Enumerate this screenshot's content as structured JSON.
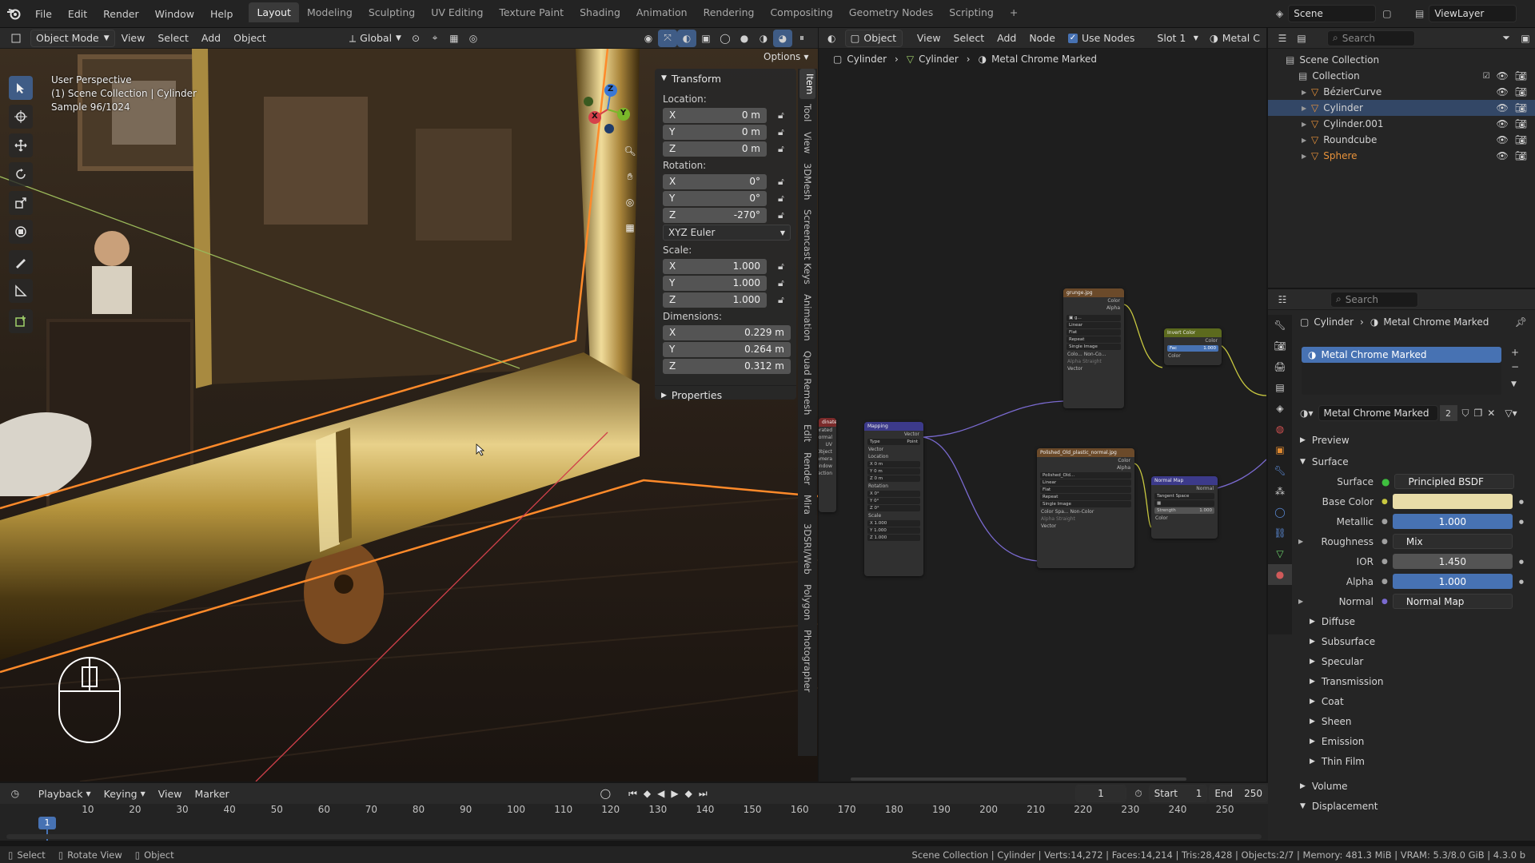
{
  "app": {
    "menus": [
      "File",
      "Edit",
      "Render",
      "Window",
      "Help"
    ],
    "workspaces": [
      "Layout",
      "Modeling",
      "Sculpting",
      "UV Editing",
      "Texture Paint",
      "Shading",
      "Animation",
      "Rendering",
      "Compositing",
      "Geometry Nodes",
      "Scripting"
    ],
    "active_workspace": "Layout",
    "add_tab": "+",
    "scene": "Scene",
    "view_layer": "ViewLayer"
  },
  "viewport": {
    "header": {
      "mode": "Object Mode",
      "menus": [
        "View",
        "Select",
        "Add",
        "Object"
      ],
      "orientation": "Global",
      "options": "Options"
    },
    "overlay": {
      "line1": "User Perspective",
      "line2": "(1) Scene Collection | Cylinder",
      "line3": "Sample 96/1024"
    },
    "gizmo": {
      "x": "X",
      "y": "Y",
      "z": "Z"
    }
  },
  "npanel": {
    "transform_title": "Transform",
    "location_label": "Location:",
    "location": [
      {
        "axis": "X",
        "value": "0 m"
      },
      {
        "axis": "Y",
        "value": "0 m"
      },
      {
        "axis": "Z",
        "value": "0 m"
      }
    ],
    "rotation_label": "Rotation:",
    "rotation": [
      {
        "axis": "X",
        "value": "0°"
      },
      {
        "axis": "Y",
        "value": "0°"
      },
      {
        "axis": "Z",
        "value": "-270°"
      }
    ],
    "rotation_mode": "XYZ Euler",
    "scale_label": "Scale:",
    "scale": [
      {
        "axis": "X",
        "value": "1.000"
      },
      {
        "axis": "Y",
        "value": "1.000"
      },
      {
        "axis": "Z",
        "value": "1.000"
      }
    ],
    "dimensions_label": "Dimensions:",
    "dimensions": [
      {
        "axis": "X",
        "value": "0.229 m"
      },
      {
        "axis": "Y",
        "value": "0.264 m"
      },
      {
        "axis": "Z",
        "value": "0.312 m"
      }
    ],
    "properties_title": "Properties"
  },
  "side_tabs": [
    "Item",
    "Tool",
    "View",
    "3DMesh",
    "Screencast Keys",
    "Animation",
    "Quad Remesh",
    "Edit",
    "Render",
    "Mira",
    "3DSRI/Web",
    "Polygon",
    "Photographer"
  ],
  "node_editor": {
    "header": {
      "object": "Object",
      "menus": [
        "View",
        "Select",
        "Add",
        "Node"
      ],
      "use_nodes": "Use Nodes",
      "slot": "Slot 1",
      "material": "Metal C"
    },
    "breadcrumb": [
      "Cylinder",
      "Cylinder",
      "Metal Chrome Marked"
    ],
    "nodes": {
      "grunge": {
        "title": "grunge.jpg",
        "outputs": [
          "Color",
          "Alpha"
        ],
        "fields": [
          "Linear",
          "Flat",
          "Repeat",
          "Single Image",
          "Colo...   Non-Co...",
          "Alpha   Straight"
        ],
        "input": "Vector"
      },
      "invert": {
        "title": "Invert Color",
        "fac": "Fac",
        "fac_value": "1.000",
        "inputs": [
          "Color"
        ],
        "output": "Color"
      },
      "texcoord": {
        "title": "dinate",
        "outputs": [
          "erated",
          "ormal",
          "UV",
          "Object",
          "amera",
          "indow",
          "ection"
        ]
      },
      "mapping": {
        "title": "Mapping",
        "output": "Vector",
        "type_label": "Type",
        "type_value": "Point",
        "vector": "Vector",
        "location": "Location",
        "rotation": "Rotation",
        "scale": "Scale",
        "loc_values": [
          "X   0 m",
          "Y   0 m",
          "Z   0 m"
        ],
        "rot_values": [
          "X   0°",
          "Y   0°",
          "Z   0°"
        ],
        "scale_values": [
          "X   1.000",
          "Y   1.000",
          "Z   1.000"
        ]
      },
      "polished": {
        "title": "Polished_Old_plastic_normal.jpg",
        "outputs": [
          "Color",
          "Alpha"
        ],
        "image_name": "Polished_Old...",
        "fields": [
          "Linear",
          "Flat",
          "Repeat",
          "Single Image",
          "Color Spa...  Non-Color",
          "Alpha   Straight"
        ],
        "input": "Vector"
      },
      "normalmap": {
        "title": "Normal Map",
        "output": "Normal",
        "space": "Tangent Space",
        "strength_label": "Strength",
        "strength_value": "1.000",
        "input": "Color"
      }
    }
  },
  "outliner": {
    "search_placeholder": "Search",
    "items": [
      {
        "name": "Scene Collection",
        "level": 0,
        "selected": false
      },
      {
        "name": "Collection",
        "level": 1,
        "selected": false
      },
      {
        "name": "BézierCurve",
        "level": 2,
        "selected": false
      },
      {
        "name": "Cylinder",
        "level": 2,
        "selected": true
      },
      {
        "name": "Cylinder.001",
        "level": 2,
        "selected": false
      },
      {
        "name": "Roundcube",
        "level": 2,
        "selected": false
      },
      {
        "name": "Sphere",
        "level": 2,
        "selected": false
      }
    ]
  },
  "properties": {
    "search_placeholder": "Search",
    "breadcrumb": [
      "Cylinder",
      "Metal Chrome Marked"
    ],
    "slot_name": "Metal Chrome Marked",
    "material_name": "Metal Chrome Marked",
    "user_count": "2",
    "sections": {
      "preview": "Preview",
      "surface": "Surface"
    },
    "surface_label": "Surface",
    "surface_value": "Principled BSDF",
    "rows": [
      {
        "label": "Base Color",
        "value": "",
        "kind": "color"
      },
      {
        "label": "Metallic",
        "value": "1.000",
        "kind": "blue"
      },
      {
        "label": "Roughness",
        "value": "Mix",
        "kind": "link"
      },
      {
        "label": "IOR",
        "value": "1.450",
        "kind": "num"
      },
      {
        "label": "Alpha",
        "value": "1.000",
        "kind": "blue"
      },
      {
        "label": "Normal",
        "value": "Normal Map",
        "kind": "link"
      }
    ],
    "subsections": [
      "Diffuse",
      "Subsurface",
      "Specular",
      "Transmission",
      "Coat",
      "Sheen",
      "Emission",
      "Thin Film"
    ],
    "volume": "Volume",
    "displacement": "Displacement",
    "base_color_hex": "#e8dca8"
  },
  "timeline": {
    "menus": [
      "Playback",
      "Keying",
      "View",
      "Marker"
    ],
    "current_frame": "1",
    "start_label": "Start",
    "start": "1",
    "end_label": "End",
    "end": "250",
    "ticks": [
      "1",
      "10",
      "20",
      "30",
      "40",
      "50",
      "60",
      "70",
      "80",
      "90",
      "100",
      "110",
      "120",
      "130",
      "140",
      "150",
      "160",
      "170",
      "180",
      "190",
      "200",
      "210",
      "220",
      "230",
      "240",
      "250"
    ]
  },
  "statusbar": {
    "select": "Select",
    "rotate": "Rotate View",
    "object": "Object",
    "info": "Scene Collection | Cylinder | Verts:14,272 | Faces:14,214 | Tris:28,428 | Objects:2/7 | Memory: 481.3 MiB | VRAM: 5.3/8.0 GiB | 4.3.0 b"
  },
  "colors": {
    "accent": "#4772b3",
    "selection_outline": "#ff8a2a",
    "header": "#2a2a2a",
    "panel": "#252525"
  }
}
